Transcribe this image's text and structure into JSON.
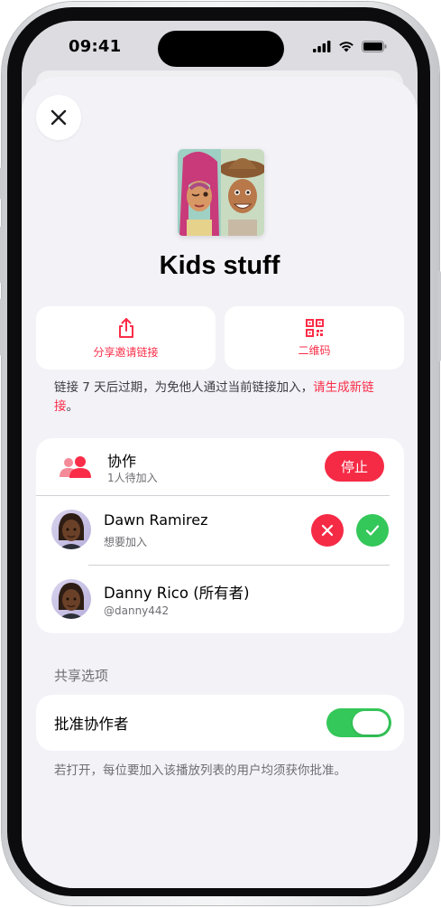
{
  "status_bar": {
    "time": "09:41"
  },
  "playlist": {
    "title": "Kids stuff"
  },
  "actions": {
    "share_link_label": "分享邀请链接",
    "qr_code_label": "二维码"
  },
  "expiry_note": {
    "text": "链接 7 天后过期，为免他人通过当前链接加入，",
    "link_text": "请生成新链接",
    "end": "。"
  },
  "collaboration": {
    "title": "协作",
    "subtitle": "1人待加入",
    "stop_label": "停止"
  },
  "members": [
    {
      "name": "Dawn Ramirez",
      "subtitle": "想要加入"
    },
    {
      "name": "Danny Rico (所有者)",
      "subtitle": "@danny442"
    }
  ],
  "sharing_options": {
    "header": "共享选项",
    "approve_label": "批准协作者",
    "approve_enabled": true,
    "footnote": "若打开，每位要加入该播放列表的用户均须获你批准。"
  },
  "colors": {
    "accent": "#fa2d48",
    "stop_bg": "#f52b46",
    "decline": "#f52b46",
    "approve": "#34c759",
    "toggle_on": "#34c759"
  },
  "icons": {
    "close": "close-icon",
    "share": "share-icon",
    "qr": "qr-code-icon",
    "collab": "people-icon",
    "decline": "xmark-icon",
    "approve": "checkmark-icon"
  }
}
